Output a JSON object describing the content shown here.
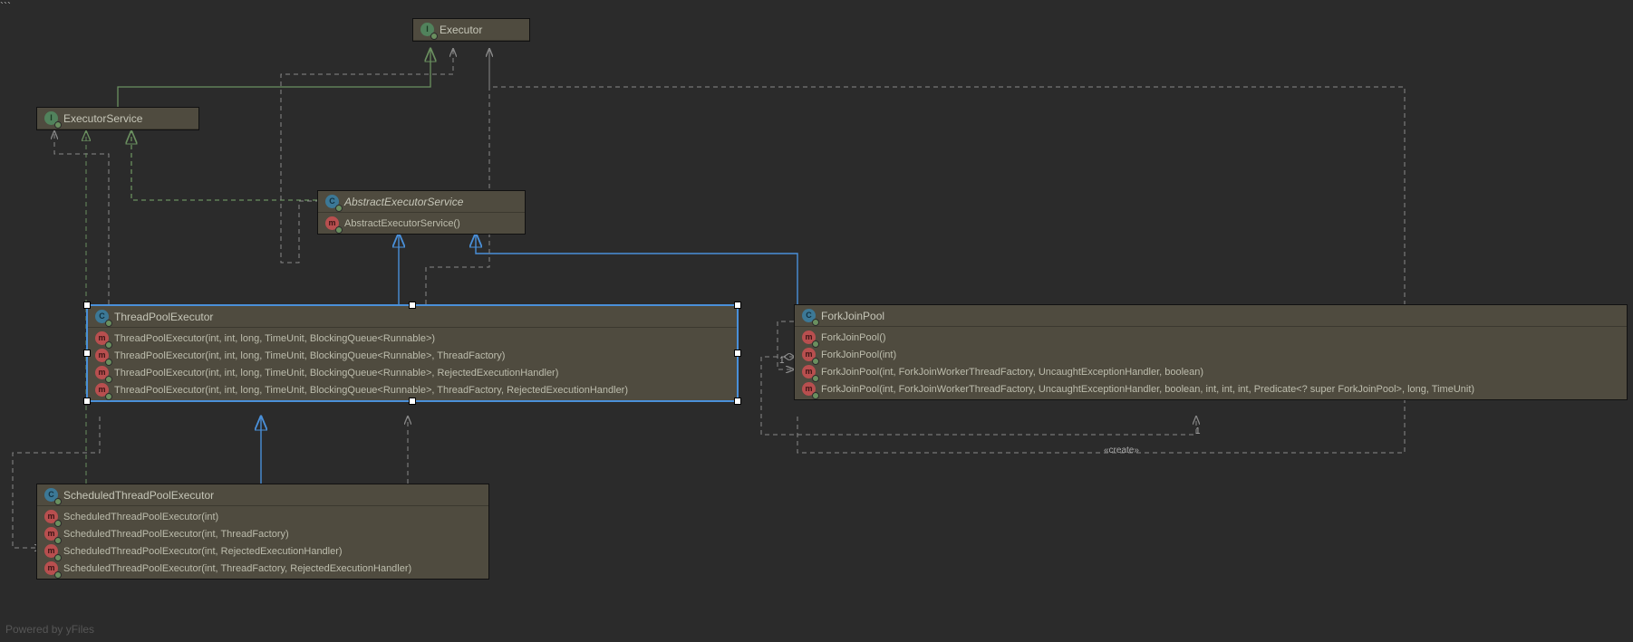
{
  "footer": "Powered by yFiles",
  "nodes": {
    "executor": {
      "name": "Executor",
      "kind": "interface"
    },
    "executorService": {
      "name": "ExecutorService",
      "kind": "interface"
    },
    "abstractExecutorService": {
      "name": "AbstractExecutorService",
      "kind": "class",
      "abstract": true,
      "members": [
        {
          "kind": "m",
          "text": "AbstractExecutorService()"
        }
      ]
    },
    "threadPoolExecutor": {
      "name": "ThreadPoolExecutor",
      "kind": "class",
      "selected": true,
      "members": [
        {
          "kind": "m",
          "text": "ThreadPoolExecutor(int, int, long, TimeUnit, BlockingQueue<Runnable>)"
        },
        {
          "kind": "m",
          "text": "ThreadPoolExecutor(int, int, long, TimeUnit, BlockingQueue<Runnable>, ThreadFactory)"
        },
        {
          "kind": "m",
          "text": "ThreadPoolExecutor(int, int, long, TimeUnit, BlockingQueue<Runnable>, RejectedExecutionHandler)"
        },
        {
          "kind": "m",
          "text": "ThreadPoolExecutor(int, int, long, TimeUnit, BlockingQueue<Runnable>, ThreadFactory, RejectedExecutionHandler)"
        }
      ]
    },
    "forkJoinPool": {
      "name": "ForkJoinPool",
      "kind": "class",
      "members": [
        {
          "kind": "m",
          "text": "ForkJoinPool()"
        },
        {
          "kind": "m",
          "text": "ForkJoinPool(int)"
        },
        {
          "kind": "m",
          "text": "ForkJoinPool(int, ForkJoinWorkerThreadFactory, UncaughtExceptionHandler, boolean)"
        },
        {
          "kind": "m",
          "text": "ForkJoinPool(int, ForkJoinWorkerThreadFactory, UncaughtExceptionHandler, boolean, int, int, int, Predicate<? super ForkJoinPool>, long, TimeUnit)"
        }
      ]
    },
    "scheduledThreadPoolExecutor": {
      "name": "ScheduledThreadPoolExecutor",
      "kind": "class",
      "members": [
        {
          "kind": "m",
          "text": "ScheduledThreadPoolExecutor(int)"
        },
        {
          "kind": "m",
          "text": "ScheduledThreadPoolExecutor(int, ThreadFactory)"
        },
        {
          "kind": "m",
          "text": "ScheduledThreadPoolExecutor(int, RejectedExecutionHandler)"
        },
        {
          "kind": "m",
          "text": "ScheduledThreadPoolExecutor(int, ThreadFactory, RejectedExecutionHandler)"
        }
      ]
    }
  },
  "labels": {
    "create": "«create»",
    "one_a": "1",
    "one_b": "1"
  }
}
